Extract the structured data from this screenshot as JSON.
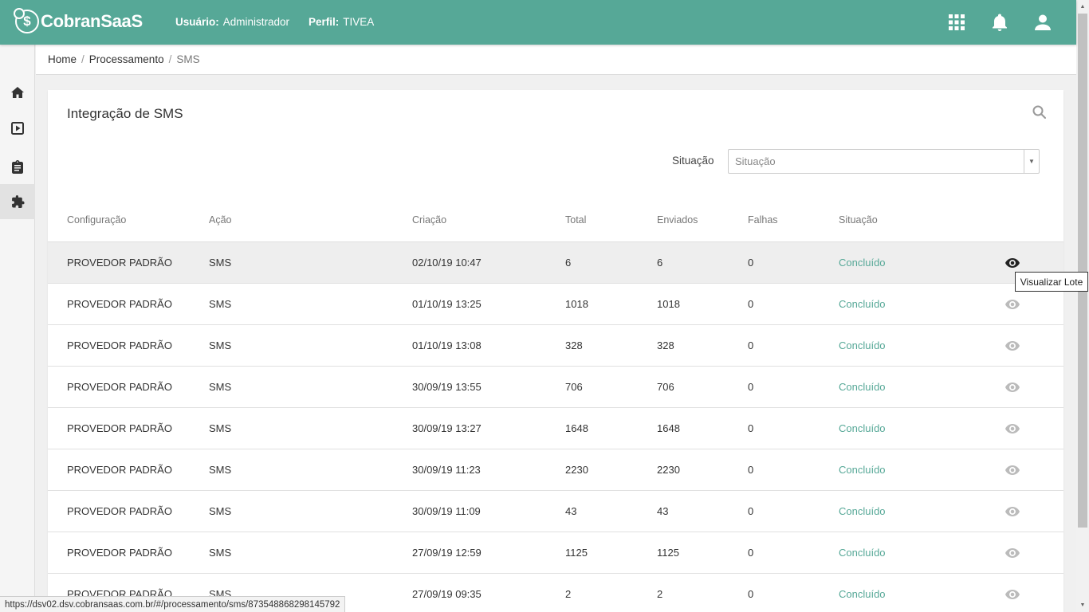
{
  "header": {
    "logo_text": "CobranSaaS",
    "user_label": "Usuário:",
    "user_value": "Administrador",
    "profile_label": "Perfil:",
    "profile_value": "TIVEA",
    "icons": [
      "apps-grid-icon",
      "bell-icon",
      "user-icon"
    ]
  },
  "sidebar": {
    "items": [
      {
        "icon": "home-icon"
      },
      {
        "icon": "play-icon"
      },
      {
        "icon": "clipboard-icon"
      },
      {
        "icon": "puzzle-icon",
        "active": true
      }
    ]
  },
  "breadcrumb": {
    "home": "Home",
    "processamento": "Processamento",
    "current": "SMS"
  },
  "page": {
    "title": "Integração de SMS",
    "filter_label": "Situação",
    "filter_placeholder": "Situação"
  },
  "table": {
    "headers": [
      "Configuração",
      "Ação",
      "Criação",
      "Total",
      "Enviados",
      "Falhas",
      "Situação"
    ],
    "rows": [
      {
        "config": "PROVEDOR PADRÃO",
        "acao": "SMS",
        "criacao": "02/10/19 10:47",
        "total": "6",
        "enviados": "6",
        "falhas": "0",
        "situacao": "Concluído"
      },
      {
        "config": "PROVEDOR PADRÃO",
        "acao": "SMS",
        "criacao": "01/10/19 13:25",
        "total": "1018",
        "enviados": "1018",
        "falhas": "0",
        "situacao": "Concluído"
      },
      {
        "config": "PROVEDOR PADRÃO",
        "acao": "SMS",
        "criacao": "01/10/19 13:08",
        "total": "328",
        "enviados": "328",
        "falhas": "0",
        "situacao": "Concluído"
      },
      {
        "config": "PROVEDOR PADRÃO",
        "acao": "SMS",
        "criacao": "30/09/19 13:55",
        "total": "706",
        "enviados": "706",
        "falhas": "0",
        "situacao": "Concluído"
      },
      {
        "config": "PROVEDOR PADRÃO",
        "acao": "SMS",
        "criacao": "30/09/19 13:27",
        "total": "1648",
        "enviados": "1648",
        "falhas": "0",
        "situacao": "Concluído"
      },
      {
        "config": "PROVEDOR PADRÃO",
        "acao": "SMS",
        "criacao": "30/09/19 11:23",
        "total": "2230",
        "enviados": "2230",
        "falhas": "0",
        "situacao": "Concluído"
      },
      {
        "config": "PROVEDOR PADRÃO",
        "acao": "SMS",
        "criacao": "30/09/19 11:09",
        "total": "43",
        "enviados": "43",
        "falhas": "0",
        "situacao": "Concluído"
      },
      {
        "config": "PROVEDOR PADRÃO",
        "acao": "SMS",
        "criacao": "27/09/19 12:59",
        "total": "1125",
        "enviados": "1125",
        "falhas": "0",
        "situacao": "Concluído"
      },
      {
        "config": "PROVEDOR PADRÃO",
        "acao": "SMS",
        "criacao": "27/09/19 09:35",
        "total": "2",
        "enviados": "2",
        "falhas": "0",
        "situacao": "Concluído"
      }
    ]
  },
  "tooltip": "Visualizar Lote",
  "status_url": "https://dsv02.dsv.cobransaas.com.br/#/processamento/sms/873548868298145792",
  "colors": {
    "primary": "#56a897",
    "status_text": "#56a897"
  }
}
